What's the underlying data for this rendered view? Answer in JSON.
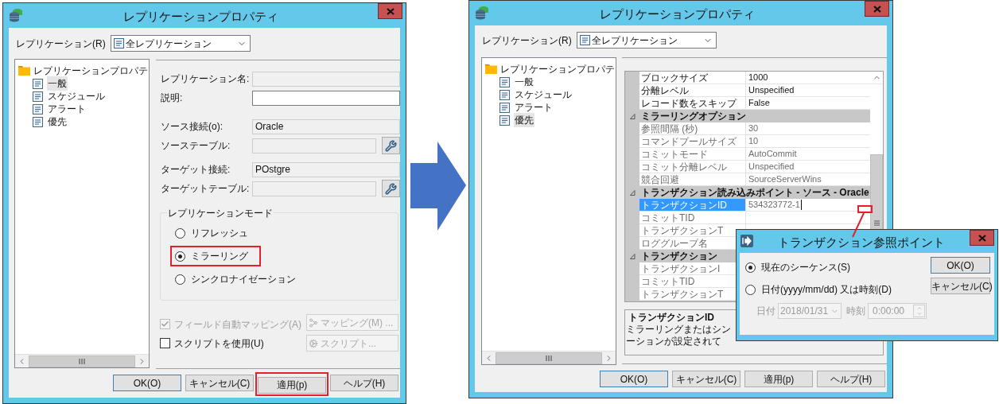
{
  "left_dialog": {
    "title": "レプリケーションプロパティ",
    "replication": {
      "label": "レプリケーション(R)",
      "value": "全レプリケーション"
    },
    "tree": {
      "root": "レプリケーションプロパテ",
      "items": [
        {
          "label": "一般",
          "selected": true
        },
        {
          "label": "スケジュール",
          "selected": false
        },
        {
          "label": "アラート",
          "selected": false
        },
        {
          "label": "優先",
          "selected": false
        }
      ]
    },
    "field_groups": [
      {
        "fields": [
          {
            "kind": "readonly",
            "label": "レプリケーション名:"
          },
          {
            "kind": "text",
            "label": "説明:"
          }
        ]
      },
      {
        "fields": [
          {
            "kind": "readonly",
            "label": "ソース接続(o):",
            "value": "Oracle"
          },
          {
            "kind": "browse",
            "label": "ソーステーブル:"
          }
        ]
      },
      {
        "fields": [
          {
            "kind": "readonly",
            "label": "ターゲット接続:",
            "value": "POstgre"
          },
          {
            "kind": "browse",
            "label": "ターゲットテーブル:"
          }
        ]
      }
    ],
    "mode_group": {
      "title": "レプリケーションモード",
      "options": [
        {
          "label": "リフレッシュ",
          "selected": false,
          "highlighted": false
        },
        {
          "label": "ミラーリング",
          "selected": true,
          "highlighted": true
        },
        {
          "label": "シンクロナイゼーション",
          "selected": false,
          "highlighted": false
        }
      ]
    },
    "checkboxes": [
      {
        "label": "フィールド自動マッピング(A)",
        "checked": true,
        "disabled": true
      },
      {
        "label": "スクリプトを使用(U)",
        "checked": false,
        "disabled": false
      }
    ],
    "side_buttons": [
      {
        "kind": "mapping",
        "label": "マッピング(M) ...",
        "disabled": true
      },
      {
        "kind": "script",
        "label": "スクリプト...",
        "disabled": true
      }
    ],
    "buttons": [
      {
        "label": "OK(O)",
        "default": true,
        "highlighted": false
      },
      {
        "label": "キャンセル(C)",
        "default": false,
        "highlighted": false
      },
      {
        "label": "適用(p)",
        "default": false,
        "highlighted": true
      },
      {
        "label": "ヘルプ(H)",
        "default": false,
        "highlighted": false
      }
    ]
  },
  "right_dialog": {
    "title": "レプリケーションプロパティ",
    "replication": {
      "label": "レプリケーション(R)",
      "value": "全レプリケーション"
    },
    "tree": {
      "root": "レプリケーションプロパテ",
      "items": [
        {
          "label": "一般",
          "selected": false
        },
        {
          "label": "スケジュール",
          "selected": false
        },
        {
          "label": "アラート",
          "selected": false
        },
        {
          "label": "優先",
          "selected": true
        }
      ]
    },
    "property_grid": {
      "rows": [
        {
          "kind": "property",
          "label": "ブロックサイズ",
          "value": "1000",
          "readonly": false,
          "selected": false
        },
        {
          "kind": "property",
          "label": "分離レベル",
          "value": "Unspecified",
          "readonly": false,
          "selected": false
        },
        {
          "kind": "property",
          "label": "レコード数をスキップ",
          "value": "False",
          "readonly": false,
          "selected": false
        },
        {
          "kind": "section",
          "label": "ミラーリングオプション",
          "expanded": true
        },
        {
          "kind": "property",
          "label": "参照間隔 (秒)",
          "value": "30",
          "readonly": true,
          "selected": false
        },
        {
          "kind": "property",
          "label": "コマンドプールサイズ",
          "value": "10",
          "readonly": true,
          "selected": false
        },
        {
          "kind": "property",
          "label": "コミットモード",
          "value": "AutoCommit",
          "readonly": true,
          "selected": false
        },
        {
          "kind": "property",
          "label": "コミット分離レベル",
          "value": "Unspecified",
          "readonly": true,
          "selected": false
        },
        {
          "kind": "property",
          "label": "競合回避",
          "value": "SourceServerWins",
          "readonly": true,
          "selected": false
        },
        {
          "kind": "section",
          "label": "トランザクション読み込みポイント - ソース - Oracle",
          "expanded": true
        },
        {
          "kind": "property",
          "label": "トランザクションID",
          "value": "534323772-1",
          "readonly": true,
          "selected": true
        },
        {
          "kind": "property",
          "label": "コミットTID",
          "readonly": true,
          "selected": false
        },
        {
          "kind": "property",
          "label": "トランザクションT",
          "readonly": true,
          "selected": false
        },
        {
          "kind": "property",
          "label": "ロググループ名",
          "readonly": true,
          "selected": false
        },
        {
          "kind": "section",
          "label": "トランザクション",
          "expanded": true
        },
        {
          "kind": "property",
          "label": "トランザクションI",
          "readonly": true,
          "selected": false
        },
        {
          "kind": "property",
          "label": "コミットTID",
          "readonly": true,
          "selected": false
        },
        {
          "kind": "property",
          "label": "トランザクションT",
          "readonly": true,
          "selected": false
        }
      ]
    },
    "description": {
      "title": "トランザクションID",
      "lines": [
        "ミラーリングまたはシン",
        "ーションが設定されて"
      ]
    },
    "buttons": [
      {
        "label": "OK(O)",
        "default": true,
        "highlighted": false
      },
      {
        "label": "キャンセル(C)",
        "default": false,
        "highlighted": false
      },
      {
        "label": "適用(p)",
        "default": false,
        "highlighted": false
      },
      {
        "label": "ヘルプ(H)",
        "default": false,
        "highlighted": false
      }
    ]
  },
  "popup_dialog": {
    "title": "トランザクション参照ポイント",
    "options": [
      {
        "label": "現在のシーケンス(S)",
        "selected": true
      },
      {
        "label": "日付(yyyy/mm/dd) 又は時刻(D)",
        "selected": false
      }
    ],
    "date": {
      "label": "日付",
      "value": "2018/01/31"
    },
    "time": {
      "label": "時刻",
      "value": "0:00:00"
    },
    "date_time_disabled": true,
    "buttons": [
      {
        "label": "OK(O)",
        "default": true,
        "highlighted": false
      },
      {
        "label": "キャンセル(C)",
        "default": false,
        "highlighted": false
      }
    ]
  }
}
